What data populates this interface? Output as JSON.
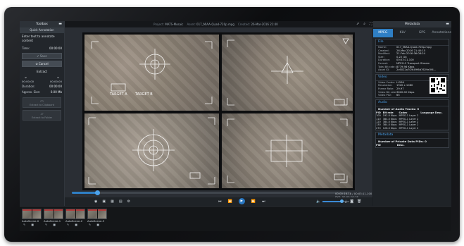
{
  "header": {
    "project_label": "Project:",
    "project_value": "MATS-Mosaic",
    "asset_label": "Asset:",
    "asset_value": "017_MIAA-Quad-720p.mpg",
    "created_label": "Created:",
    "created_value": "26-Mar-2016 21:40"
  },
  "toolbox": {
    "title": "Toolbox",
    "subtitle": "Quick Annotation",
    "prompt": "Enter text to annotate content",
    "time_label": "Time:",
    "time_value": "00:00:00",
    "save_label": "✔ Save",
    "cancel_label": "⊘ Cancel",
    "extract_label": "Extract",
    "start_time": "00:00:00",
    "end_time": "00:00:00",
    "duration_label": "Duration:",
    "duration_value": "00:00:00",
    "size_label": "Approx. Size:",
    "size_value": "0.00 Mb",
    "extract_clip_label": "Extract to Clipboard",
    "extract_folder_label": "Extract to Folder"
  },
  "viewer": {
    "target_a": "TARGET A",
    "target_b": "TARGET B",
    "timecode_1": "00:00:16.18 / 00:03:11.100",
    "timecode_2": "SYS: 00:00:16:18",
    "progress": 0.09,
    "volume": 0.7
  },
  "metadata": {
    "title": "Metadata",
    "tabs": [
      "MPEG",
      "KLV",
      "GPS",
      "Annotations"
    ],
    "active_tab": 0,
    "file_title": "File",
    "file": [
      {
        "k": "Name:",
        "v": "017_MIAA-Quad-720p.mpg"
      },
      {
        "k": "Created:",
        "v": "26-Mar-2016 21:40:15"
      },
      {
        "k": "Modified:",
        "v": "21-Feb-2016 06:08:24"
      },
      {
        "k": "Size:",
        "v": "0.22 Gb"
      },
      {
        "k": "Duration:",
        "v": "00:03:11.100"
      },
      {
        "k": "Format:",
        "v": "MPEG-2 Transport Stream"
      },
      {
        "k": "Total Bit rate:",
        "v": "8779.98 Kbps"
      },
      {
        "k": "Asset ID:",
        "v": "2c6022a7f2649f6d7629e3f4..."
      }
    ],
    "video_title": "Video",
    "video": [
      {
        "k": "Video Codec:",
        "v": "H.264"
      },
      {
        "k": "Resolution:",
        "v": "1920 x 1080"
      },
      {
        "k": "Frame Rate:",
        "v": "29.97"
      },
      {
        "k": "Video Bit rate:",
        "v": "3620.02 Kbps"
      },
      {
        "k": "Video PID:",
        "v": "65"
      }
    ],
    "audio_title": "Audio",
    "audio_count": "Number of Audio Tracks: 5",
    "audio_headers": [
      "PID",
      "Bit rate",
      "Codec",
      "Language Desc."
    ],
    "audio_rows": [
      [
        "100",
        "192.0 Kbps",
        "MPEG-1 Layer 2",
        ""
      ],
      [
        "110",
        "384.0 Kbps",
        "MPEG-1 Layer 2",
        ""
      ],
      [
        "120",
        "384.0 Kbps",
        "MPEG-1 Layer 2",
        ""
      ],
      [
        "130",
        "384.0 Kbps",
        "MPEG-1 Layer 2",
        ""
      ],
      [
        "270",
        "128.0 Kbps",
        "MPEG-1 Layer 2",
        ""
      ]
    ],
    "private_title": "Metadata",
    "private_count": "Number of Private Data PIDs: 0",
    "private_headers": [
      "PID",
      "Desc."
    ]
  },
  "thumbnails": [
    {
      "label": "AutoScene-0"
    },
    {
      "label": "AutoScene-1"
    },
    {
      "label": "AutoScene-2"
    },
    {
      "label": "AutoScene-3"
    }
  ],
  "colors": {
    "accent": "#2f7fc4",
    "panel": "#22262b",
    "section_title": "#4aa0e8"
  }
}
